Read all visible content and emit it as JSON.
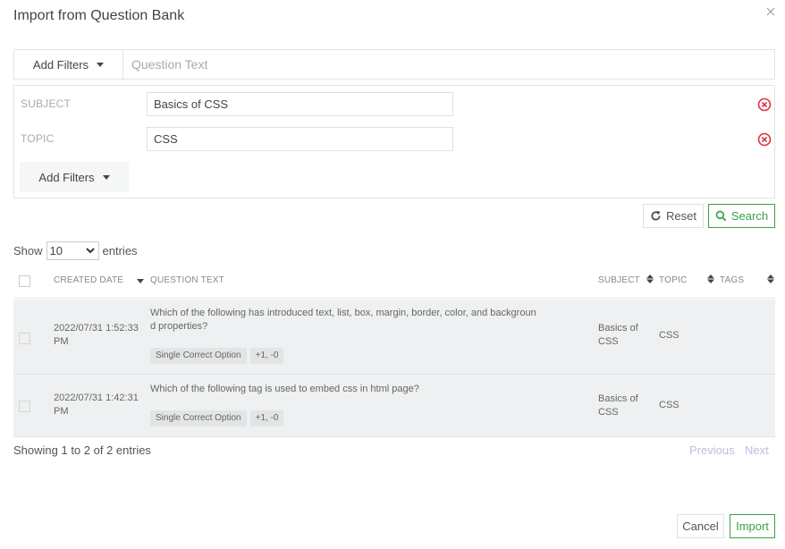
{
  "modal": {
    "title": "Import from Question Bank",
    "close_icon": "close-icon"
  },
  "search": {
    "add_filters_label": "Add Filters",
    "question_placeholder": "Question Text",
    "question_value": ""
  },
  "filters": {
    "items": [
      {
        "label": "SUBJECT",
        "value": "Basics of CSS",
        "remove_icon": "remove-circle-icon"
      },
      {
        "label": "TOPIC",
        "value": "CSS",
        "remove_icon": "remove-circle-icon"
      }
    ],
    "add_filters_label": "Add Filters",
    "remove_color": "#e0313e"
  },
  "actions": {
    "reset_label": "Reset",
    "search_label": "Search",
    "accent_color": "#3aa14a"
  },
  "entries": {
    "show_label": "Show",
    "selected": "10",
    "entries_label": "entries"
  },
  "table": {
    "columns": [
      {
        "key": "created_date",
        "label": "CREATED DATE"
      },
      {
        "key": "question_text",
        "label": "QUESTION TEXT"
      },
      {
        "key": "subject",
        "label": "SUBJECT"
      },
      {
        "key": "topic",
        "label": "TOPIC"
      },
      {
        "key": "tags",
        "label": "TAGS"
      }
    ],
    "rows": [
      {
        "created_date": "2022/07/31 1:52:33 PM",
        "question_text": "Which of the following has introduced text, list, box, margin, border, color, and backgroun d properties?",
        "question_type": "Single Correct Option",
        "marks": "+1, -0",
        "subject": "Basics of CSS",
        "topic": "CSS",
        "tags": ""
      },
      {
        "created_date": "2022/07/31 1:42:31 PM",
        "question_text": "Which of the following tag is used to embed css in html page?",
        "question_type": "Single Correct Option",
        "marks": "+1, -0",
        "subject": "Basics of CSS",
        "topic": "CSS",
        "tags": ""
      }
    ]
  },
  "footer": {
    "showing": "Showing 1 to 2 of 2 entries",
    "previous_label": "Previous",
    "next_label": "Next",
    "cancel_label": "Cancel",
    "import_label": "Import"
  }
}
